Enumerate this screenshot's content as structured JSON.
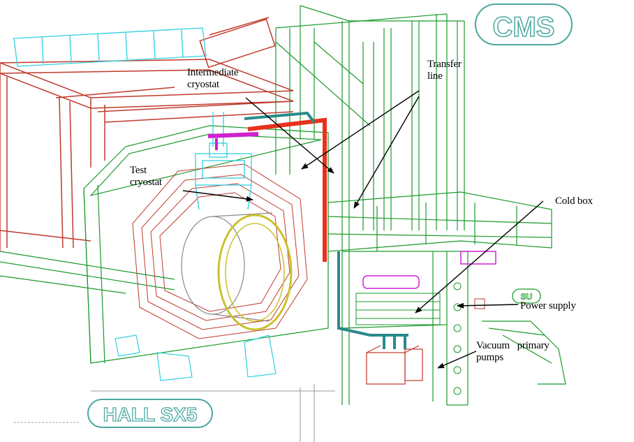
{
  "labels": {
    "intermediate_cryostat": "Intermediate\ncryostat",
    "transfer_line": "Transfer\nline",
    "test_cryostat": "Test\ncryostat",
    "cold_box": "Cold box",
    "power_supply": "Power supply",
    "vacuum_pumps": "Vacuum   primary\npumps"
  },
  "logos": {
    "cms": "CMS",
    "hall": "HALL SX5",
    "building": "SU"
  },
  "colors": {
    "structure_green": "#1a9a2a",
    "coil_red": "#c0392b",
    "transfer_line_red": "#e8311c",
    "ring_yellow": "#c9c22a",
    "cyan": "#2fd0e0",
    "teal_pipe": "#2a8a8a",
    "magenta": "#d020d0",
    "logo_outline": "#4aa8a0"
  }
}
